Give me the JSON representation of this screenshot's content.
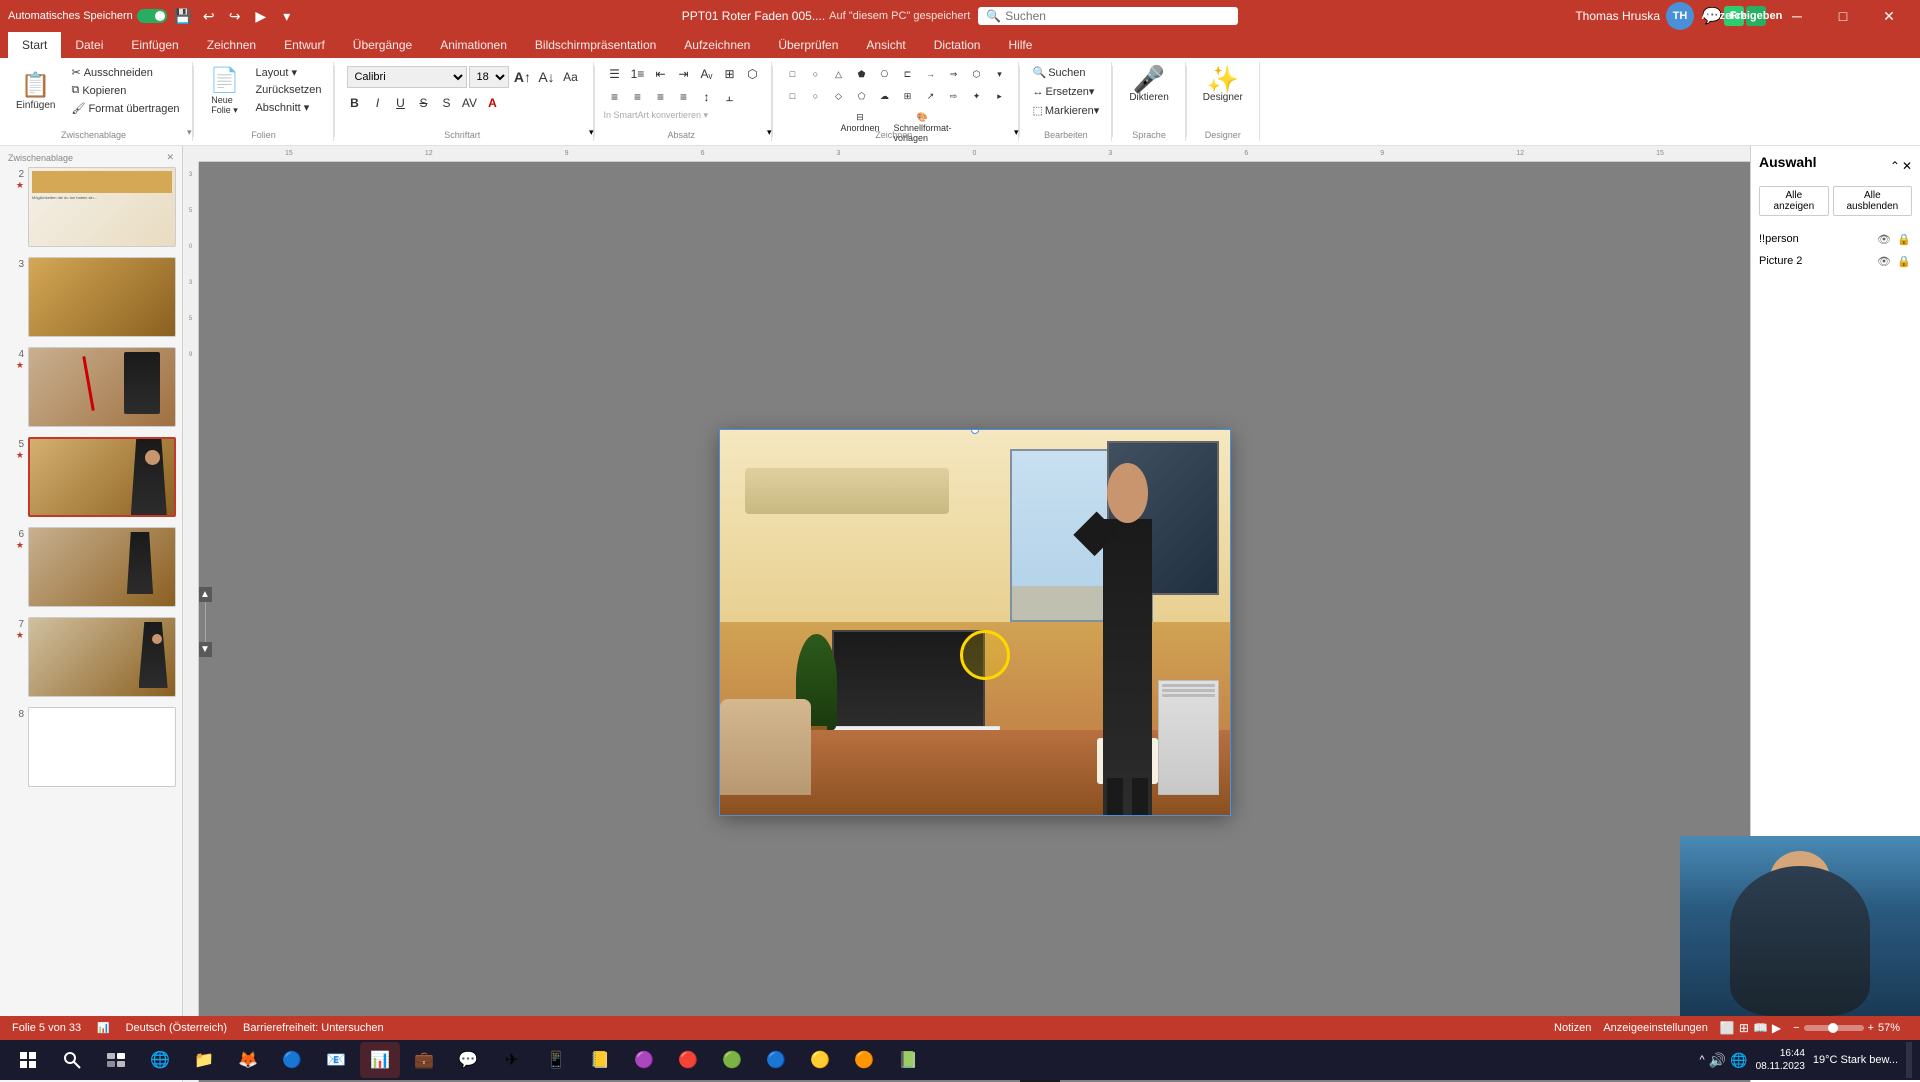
{
  "title_bar": {
    "autosave_label": "Automatisches Speichern",
    "file_title": "PPT01 Roter Faden 005....",
    "save_status": "Auf \"diesem PC\" gespeichert",
    "search_placeholder": "Suchen",
    "user_name": "Thomas Hruska",
    "user_initials": "TH"
  },
  "ribbon_tabs": [
    {
      "label": "Datei",
      "active": false
    },
    {
      "label": "Start",
      "active": true
    },
    {
      "label": "Einfügen",
      "active": false
    },
    {
      "label": "Zeichnen",
      "active": false
    },
    {
      "label": "Entwurf",
      "active": false
    },
    {
      "label": "Übergänge",
      "active": false
    },
    {
      "label": "Animationen",
      "active": false
    },
    {
      "label": "Bildschirmpräsentation",
      "active": false
    },
    {
      "label": "Aufzeichnen",
      "active": false
    },
    {
      "label": "Überprüfen",
      "active": false
    },
    {
      "label": "Ansicht",
      "active": false
    },
    {
      "label": "Dictation",
      "active": false
    },
    {
      "label": "Hilfe",
      "active": false
    }
  ],
  "ribbon": {
    "groups": {
      "zwischenablage": {
        "label": "Zwischenablage",
        "ausschneiden": "Ausschneiden",
        "kopieren": "Kopieren",
        "einfügen": "Einfügen",
        "format_übertragen": "Format übertragen"
      },
      "folien": {
        "label": "Folien",
        "neue_folie": "Neue\nFolie",
        "layout": "Layout",
        "zurücksetzen": "Zurücksetzen",
        "abschnitt": "Abschnitt"
      },
      "schriftart": {
        "label": "Schriftart",
        "font_name": "Calibri",
        "font_size": "18"
      },
      "absatz": {
        "label": "Absatz"
      },
      "zeichnen": {
        "label": "Zeichnen"
      },
      "bearbeiten": {
        "label": "Bearbeiten",
        "suchen": "Suchen",
        "ersetzen": "Ersetzen",
        "markieren": "Markieren"
      },
      "sprache": {
        "label": "Sprache",
        "diktieren": "Diktieren"
      },
      "designer": {
        "label": "Designer",
        "designer_btn": "Designer"
      }
    }
  },
  "slides": [
    {
      "num": "2",
      "has_star": true,
      "label": "Slide 2"
    },
    {
      "num": "3",
      "has_star": false,
      "label": "Slide 3"
    },
    {
      "num": "4",
      "has_star": true,
      "label": "Slide 4"
    },
    {
      "num": "5",
      "has_star": true,
      "label": "Slide 5 - active"
    },
    {
      "num": "6",
      "has_star": true,
      "label": "Slide 6"
    },
    {
      "num": "7",
      "has_star": true,
      "label": "Slide 7"
    },
    {
      "num": "8",
      "has_star": false,
      "label": "Slide 8"
    }
  ],
  "right_panel": {
    "title": "Auswahl",
    "show_all_btn": "Alle anzeigen",
    "hide_all_btn": "Alle ausblenden",
    "items": [
      {
        "label": "!!person",
        "visible": true
      },
      {
        "label": "Picture 2",
        "visible": true
      }
    ]
  },
  "status_bar": {
    "slide_info": "Folie 5 von 33",
    "language": "Deutsch (Österreich)",
    "accessibility": "Barrierefreiheit: Untersuchen",
    "notes": "Notizen",
    "display_settings": "Anzeigeeinstellungen"
  },
  "taskbar": {
    "time": "19°C  Stark bew..."
  }
}
